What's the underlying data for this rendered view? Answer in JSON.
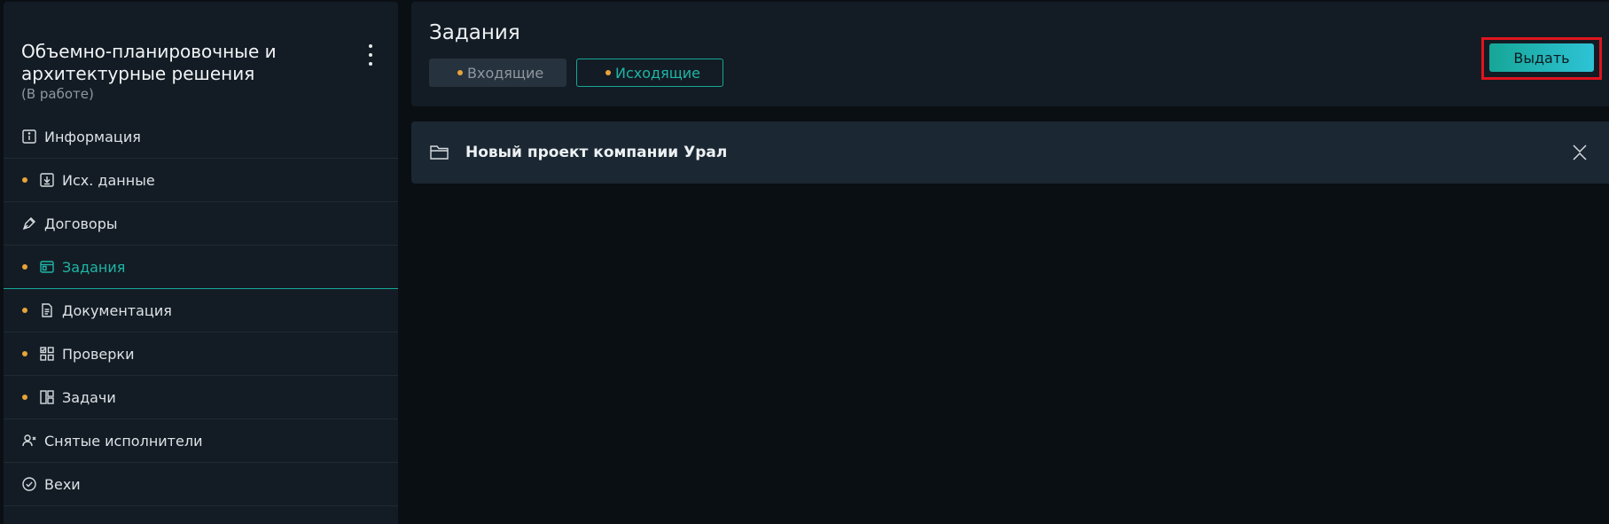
{
  "sidebar": {
    "title": "Объемно-планировочные и архитектурные решения",
    "status": "(В работе)",
    "items": [
      {
        "label": "Информация",
        "icon": "info-icon",
        "dot": false
      },
      {
        "label": "Исх. данные",
        "icon": "download-box-icon",
        "dot": true
      },
      {
        "label": "Договоры",
        "icon": "pen-nib-icon",
        "dot": false
      },
      {
        "label": "Задания",
        "icon": "window-icon",
        "dot": true,
        "active": true
      },
      {
        "label": "Документация",
        "icon": "document-icon",
        "dot": true
      },
      {
        "label": "Проверки",
        "icon": "check-grid-icon",
        "dot": true
      },
      {
        "label": "Задачи",
        "icon": "board-icon",
        "dot": true
      },
      {
        "label": "Снятые исполнители",
        "icon": "user-remove-icon",
        "dot": false
      },
      {
        "label": "Вехи",
        "icon": "check-circle-icon",
        "dot": false
      }
    ]
  },
  "header": {
    "title": "Задания",
    "tabs": [
      {
        "label": "Входящие"
      },
      {
        "label": "Исходящие",
        "active": true
      }
    ],
    "issue_label": "Выдать"
  },
  "project": {
    "name": "Новый проект компании Урал",
    "icon": "folder-icon"
  },
  "colors": {
    "accent": "#16a697",
    "dot": "#e8a33a",
    "highlight": "#e0141e"
  }
}
